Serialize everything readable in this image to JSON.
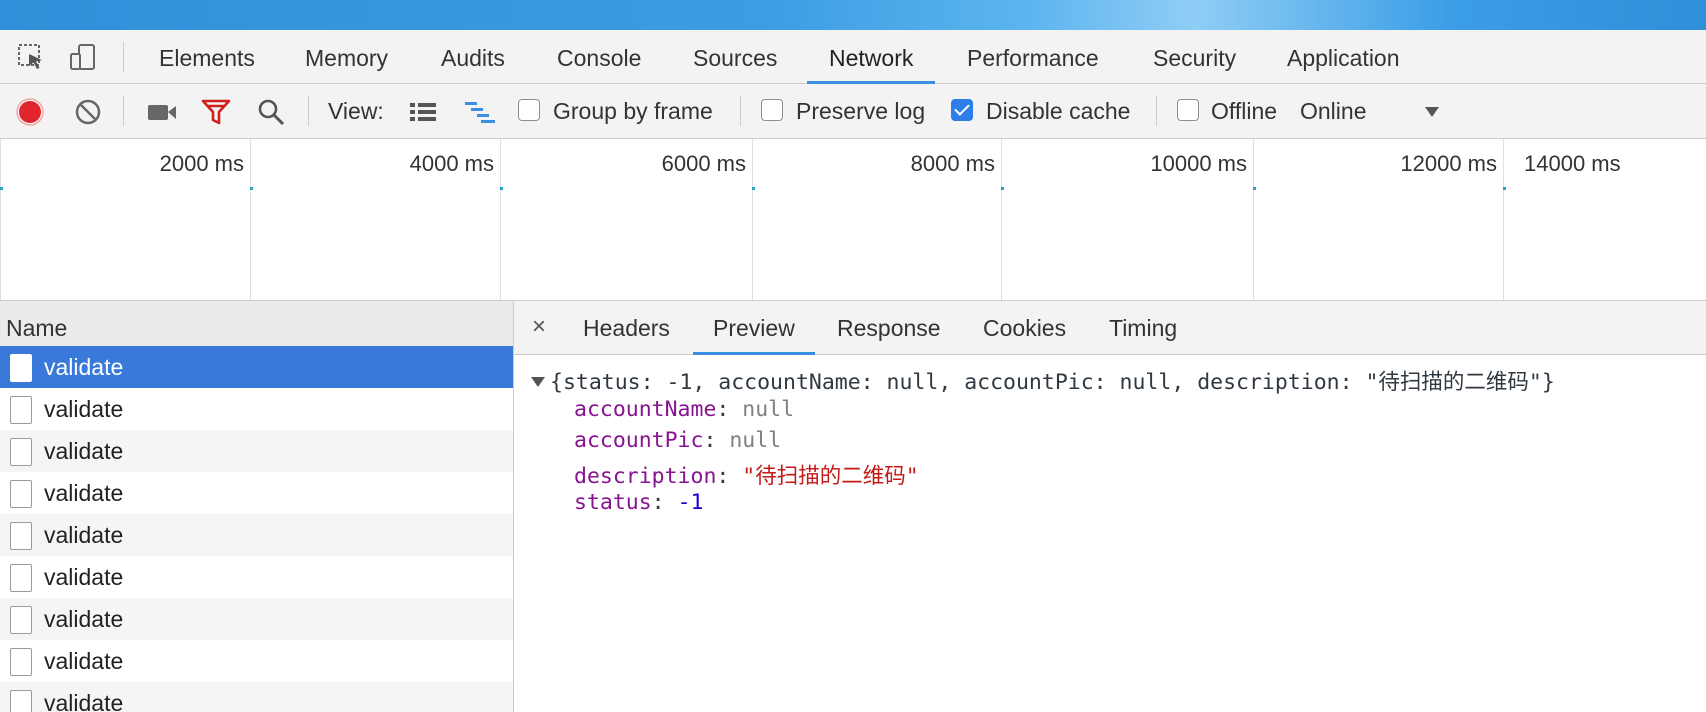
{
  "tabs": [
    {
      "label": "Elements"
    },
    {
      "label": "Memory"
    },
    {
      "label": "Audits"
    },
    {
      "label": "Console"
    },
    {
      "label": "Sources"
    },
    {
      "label": "Network"
    },
    {
      "label": "Performance"
    },
    {
      "label": "Security"
    },
    {
      "label": "Application"
    }
  ],
  "selected_tab": "Network",
  "toolbar": {
    "view_label": "View:",
    "group_by_frame": {
      "label": "Group by frame",
      "checked": false
    },
    "preserve_log": {
      "label": "Preserve log",
      "checked": false
    },
    "disable_cache": {
      "label": "Disable cache",
      "checked": true
    },
    "offline": {
      "label": "Offline",
      "checked": false
    },
    "throttle_value": "Online",
    "record_color": "#e0242b",
    "filter_color": "#d0221d"
  },
  "timeline": {
    "ticks": [
      "2000 ms",
      "4000 ms",
      "6000 ms",
      "8000 ms",
      "10000 ms",
      "12000 ms",
      "14000 ms"
    ]
  },
  "requests": {
    "header": "Name",
    "rows": [
      {
        "name": "validate",
        "selected": true
      },
      {
        "name": "validate"
      },
      {
        "name": "validate"
      },
      {
        "name": "validate"
      },
      {
        "name": "validate"
      },
      {
        "name": "validate"
      },
      {
        "name": "validate"
      },
      {
        "name": "validate"
      },
      {
        "name": "validate"
      }
    ]
  },
  "detail": {
    "close_label": "×",
    "tabs": [
      "Headers",
      "Preview",
      "Response",
      "Cookies",
      "Timing"
    ],
    "selected": "Preview",
    "preview": {
      "summary": "{status: -1, accountName: null, accountPic: null, description: \"待扫描的二维码\"}",
      "props": [
        {
          "key": "accountName",
          "value": "null",
          "type": "null"
        },
        {
          "key": "accountPic",
          "value": "null",
          "type": "null"
        },
        {
          "key": "description",
          "value": "\"待扫描的二维码\"",
          "type": "string"
        },
        {
          "key": "status",
          "value": "-1",
          "type": "number"
        }
      ]
    }
  }
}
